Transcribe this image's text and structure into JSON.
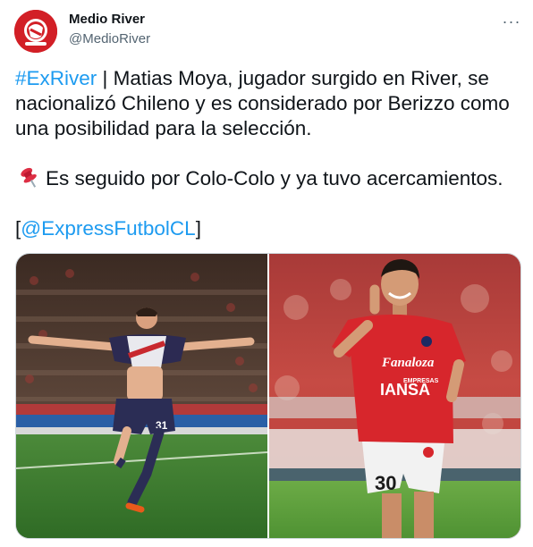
{
  "author": {
    "name": "Medio River",
    "handle": "@MedioRiver"
  },
  "more_label": "···",
  "tweet": {
    "hashtag": "#ExRiver",
    "line1_rest": " | Matias Moya, jugador surgido en River, se nacionalizó Chileno y es considerado por Berizzo como una posibilidad para la selección.",
    "line2": "Es seguido por Colo-Colo y ya tuvo acercamientos.",
    "mention_open": "[",
    "mention": "@ExpressFutbolCL",
    "mention_close": "]"
  },
  "icons": {
    "pin": "pushpin-icon",
    "more": "more-icon"
  },
  "photo2": {
    "sponsor_1": "Fanaloza",
    "sponsor_2": "EMPRESAS",
    "sponsor_3": "IANSA",
    "number": "30"
  },
  "photo1": {
    "number": "31"
  },
  "colors": {
    "link": "#1d9bf0",
    "text": "#0f1419",
    "muted": "#536471",
    "border": "#cfd9de"
  }
}
